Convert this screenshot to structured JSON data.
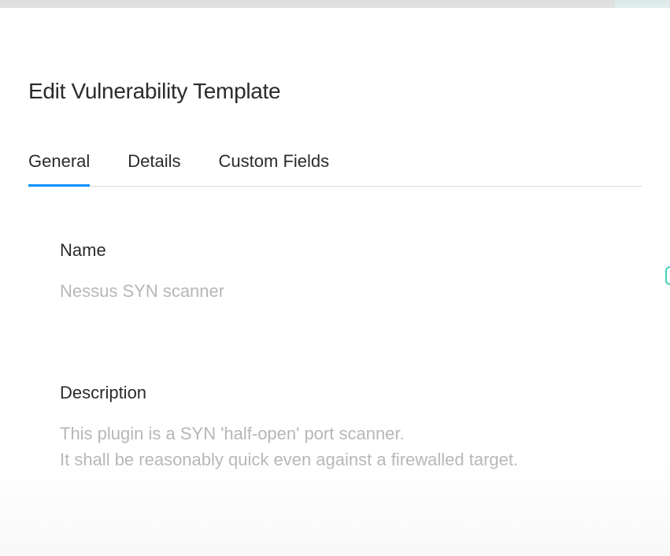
{
  "page": {
    "title": "Edit Vulnerability Template"
  },
  "tabs": {
    "general": "General",
    "details": "Details",
    "custom_fields": "Custom Fields"
  },
  "form": {
    "name": {
      "label": "Name",
      "value": "Nessus SYN scanner"
    },
    "description": {
      "label": "Description",
      "line1": "This plugin is a SYN 'half-open' port scanner.",
      "line2": "It shall be reasonably quick even against a firewalled target."
    }
  }
}
